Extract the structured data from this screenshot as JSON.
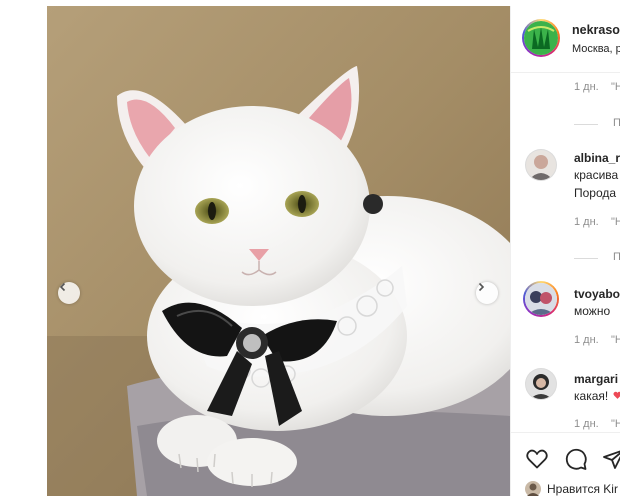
{
  "post": {
    "author": "nekraso",
    "location": "Москва, р",
    "image_alt": "white cat with black bow"
  },
  "comments": [
    {
      "time": "1 дн.",
      "reply": "\"Н",
      "view_replies": "П"
    },
    {
      "username": "albina_r",
      "lines": [
        "красива",
        "Порода"
      ],
      "time": "1 дн.",
      "reply": "\"Н",
      "view_replies": "П"
    },
    {
      "username": "tvoyabo",
      "lines": [
        "можно"
      ],
      "time": "1 дн.",
      "reply": "\"Н"
    },
    {
      "username": "margari",
      "lines": [
        "какая!"
      ],
      "time": "1 дн.",
      "reply": "\"Н"
    }
  ],
  "likes": {
    "text": "Нравится Kir"
  },
  "icons": {
    "like": "heart-icon",
    "comment": "comment-icon",
    "share": "share-icon",
    "prev": "chevron-left-icon",
    "next": "chevron-right-icon"
  },
  "colors": {
    "heart": "#ed4956",
    "border": "#efefef",
    "muted": "#8e8e8e"
  }
}
